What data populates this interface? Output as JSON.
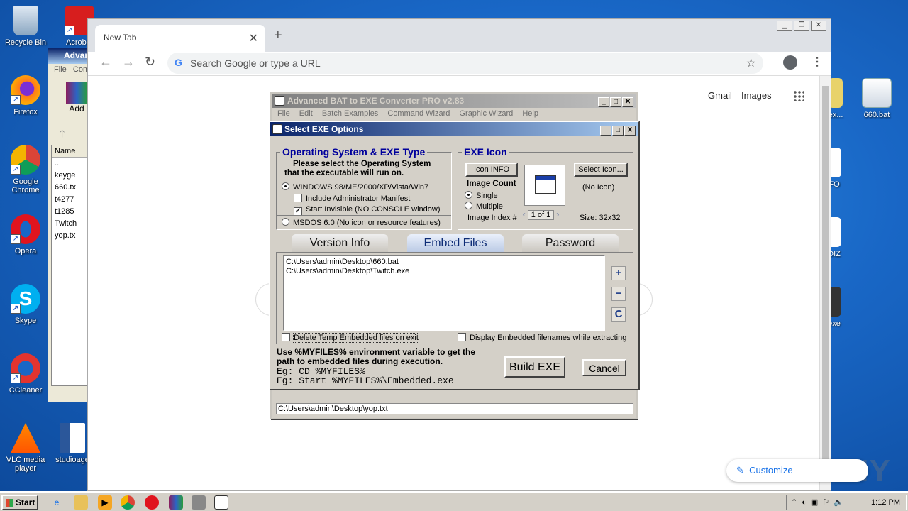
{
  "desktop": {
    "icons": [
      {
        "label": "Recycle Bin",
        "icon": "recycle-bin-icon"
      },
      {
        "label": "Acrobat",
        "icon": "acrobat-icon"
      },
      {
        "label": "Firefox",
        "icon": "firefox-icon"
      },
      {
        "label": "Google Chrome",
        "icon": "chrome-icon"
      },
      {
        "label": "Opera",
        "icon": "opera-icon"
      },
      {
        "label": "Skype",
        "icon": "skype-icon"
      },
      {
        "label": "CCleaner",
        "icon": "ccleaner-icon"
      },
      {
        "label": "VLC media player",
        "icon": "vlc-icon"
      },
      {
        "label": "studioage",
        "icon": "word-doc-icon"
      },
      {
        "label": "660.bat",
        "icon": "bat-file-icon"
      },
      {
        "label": "ex...",
        "icon": "file-icon"
      },
      {
        "label": "FO",
        "icon": "file-icon"
      },
      {
        "label": "DIZ",
        "icon": "file-icon"
      },
      {
        "label": "exe",
        "icon": "file-icon"
      }
    ]
  },
  "winrar": {
    "title": "Advan",
    "menu": [
      "File",
      "Com"
    ],
    "add_label": "Add",
    "column": "Name",
    "files": [
      "..",
      "keyge",
      "660.tx",
      "t4277",
      "t1285",
      "Twitch",
      "yop.tx"
    ]
  },
  "chrome": {
    "tab_title": "New Tab",
    "omnibox_placeholder": "Search Google or type a URL",
    "link_gmail": "Gmail",
    "link_images": "Images",
    "customize_label": "Customize",
    "watermark": "ANY RUN"
  },
  "batwin": {
    "title": "Advanced BAT to EXE Converter PRO v2.83",
    "menu": [
      "File",
      "Edit",
      "Batch Examples",
      "Command Wizard",
      "Graphic Wizard",
      "Help"
    ],
    "path": "C:\\Users\\admin\\Desktop\\yop.txt"
  },
  "dialog": {
    "title": "Select EXE Options",
    "os_group_title": "Operating System & EXE Type",
    "os_instruction_1": "Please select the Operating System",
    "os_instruction_2": "that the executable will run on.",
    "windows_option": "WINDOWS   98/ME/2000/XP/Vista/Win7",
    "admin_manifest": "Include Administrator Manifest",
    "start_invisible": "Start Invisible   (NO CONSOLE window)",
    "msdos_option": "MSDOS 6.0   (No icon or resource features)",
    "icon_group_title": "EXE Icon",
    "icon_info_button": "Icon INFO",
    "select_icon_button": "Select Icon...",
    "image_count_label": "Image Count",
    "single_option": "Single",
    "multiple_option": "Multiple",
    "image_index_label": "Image Index #",
    "image_index_value": "1 of 1",
    "no_icon_label": "(No Icon)",
    "size_label": "Size: 32x32",
    "tabs": [
      "Version Info",
      "Embed Files",
      "Password"
    ],
    "embedded_files": [
      "C:\\Users\\admin\\Desktop\\660.bat",
      "C:\\Users\\admin\\Desktop\\Twitch.exe"
    ],
    "side_buttons": [
      "+",
      "−",
      "C"
    ],
    "delete_temp": "Delete Temp Embedded files on exit",
    "display_names": "Display Embedded filenames while extracting",
    "note_1": "Use %MYFILES% environment variable to get the",
    "note_2": "path to embedded files during execution.",
    "example_1": "Eg:  CD %MYFILES%",
    "example_2": "Eg:  Start %MYFILES%\\Embedded.exe",
    "build_button": "Build EXE",
    "cancel_button": "Cancel"
  },
  "taskbar": {
    "start_label": "Start",
    "clock": "1:12 PM"
  }
}
